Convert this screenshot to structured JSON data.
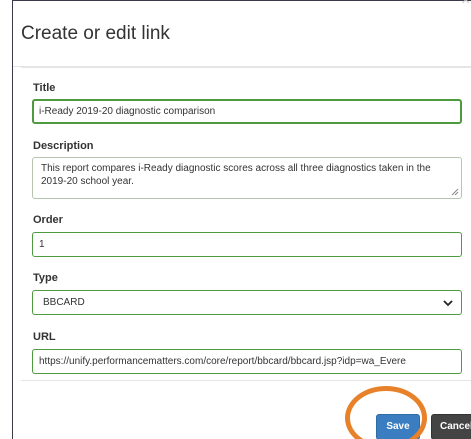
{
  "dialog": {
    "title": "Create or edit link",
    "close_glyph": "×"
  },
  "form": {
    "title_label": "Title",
    "title_value": "i-Ready 2019-20 diagnostic comparison",
    "description_label": "Description",
    "description_value": "This report compares i-Ready diagnostic scores across all three diagnostics taken in the 2019-20 school year.",
    "order_label": "Order",
    "order_value": "1",
    "type_label": "Type",
    "type_value": "BBCARD",
    "url_label": "URL",
    "url_value": "https://unify.performancematters.com/core/report/bbcard/bbcard.jsp?idp=wa_Evere"
  },
  "footer": {
    "save_label": "Save",
    "cancel_label": "Cancel"
  },
  "colors": {
    "focus_border": "#4e9a3e",
    "label_text": "#333333",
    "save_bg": "#3a7dc1",
    "cancel_bg": "#444444",
    "highlight_ring": "#e8822a"
  },
  "icons": {
    "close": "close-icon",
    "select_arrow": "chevron-down-icon",
    "resize": "resize-grip-icon"
  }
}
